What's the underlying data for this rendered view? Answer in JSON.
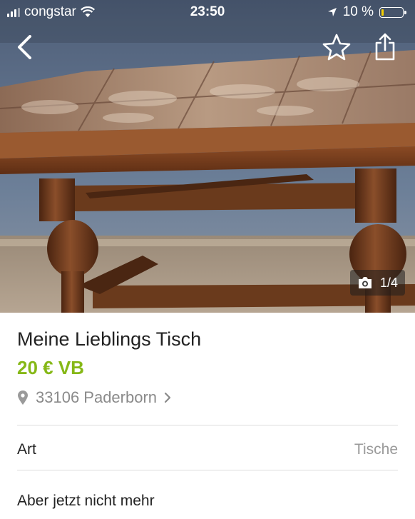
{
  "status_bar": {
    "carrier": "congstar",
    "time": "23:50",
    "battery": "10 %",
    "battery_level": 0.1
  },
  "gallery": {
    "counter": "1/4",
    "icons": {
      "back": "chevron-left-icon",
      "favorite": "star-outline-icon",
      "share": "share-icon",
      "camera": "camera-icon"
    }
  },
  "listing": {
    "title": "Meine Lieblings Tisch",
    "price": "20 € VB",
    "location": "33106 Paderborn",
    "attributes": [
      {
        "label": "Art",
        "value": "Tische"
      }
    ],
    "description": "Aber jetzt nicht mehr"
  },
  "colors": {
    "price": "#86b817",
    "battery_low": "#f5d000"
  }
}
